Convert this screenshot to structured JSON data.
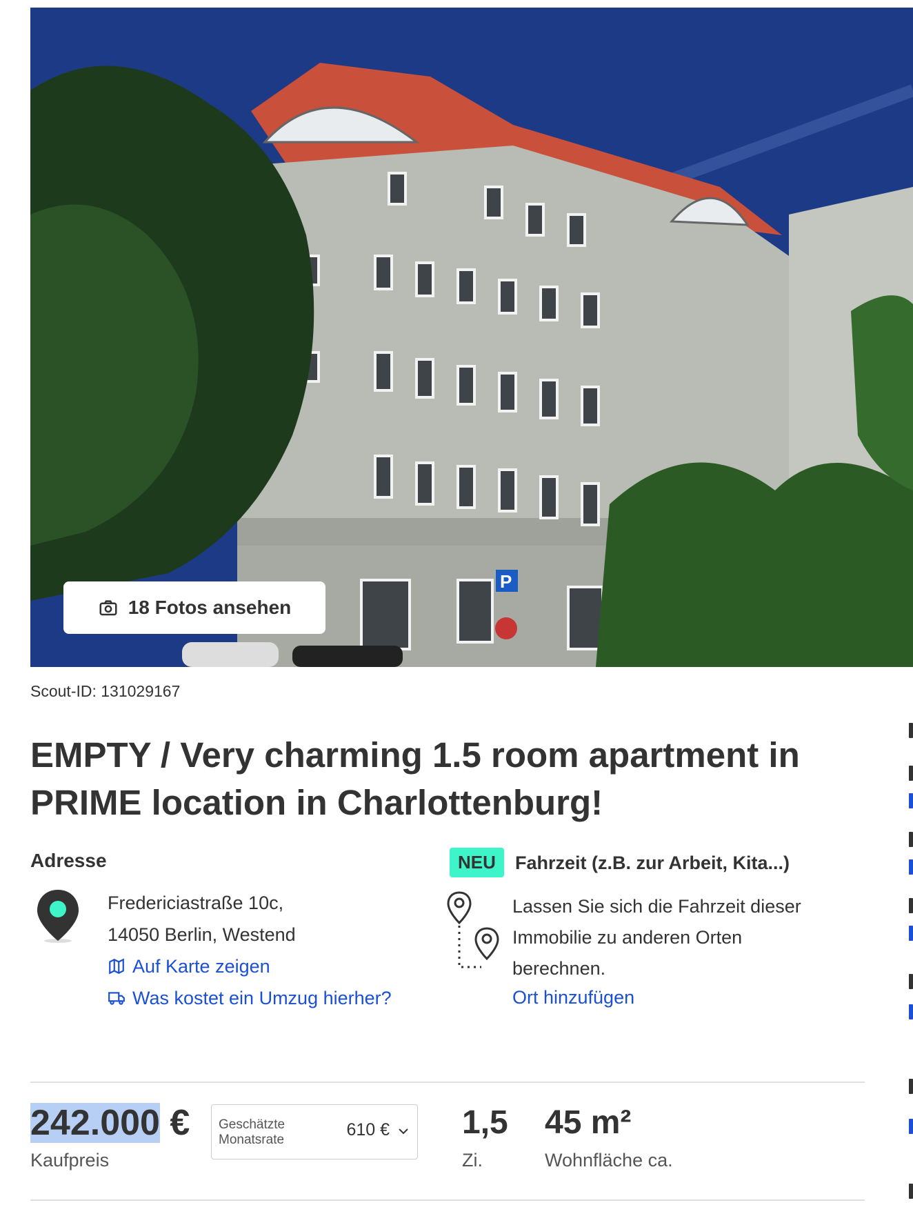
{
  "gallery": {
    "photos_button_label": "18 Fotos ansehen",
    "sky_color": "#1d3a86",
    "roof_color": "#c9503a",
    "facade_color": "#b9bcb4"
  },
  "listing": {
    "scout_id": "Scout-ID: 131029167",
    "title": "EMPTY / Very charming 1.5 room apartment in PRIME location in Charlottenburg!"
  },
  "address": {
    "heading": "Adresse",
    "street": "Fredericiastraße 10c,",
    "city": "14050 Berlin, Westend",
    "map_link": "Auf Karte zeigen",
    "moving_link": "Was kostet ein Umzug hierher?",
    "icon": "map-pin-icon"
  },
  "travel_time": {
    "badge": "NEU",
    "heading": "Fahrzeit (z.B. zur Arbeit, Kita...)",
    "description": "Lassen Sie sich die Fahrzeit dieser Immobilie zu anderen Orten berechnen.",
    "add_link": "Ort hinzufügen"
  },
  "key_facts": {
    "price_value": "242.000",
    "price_currency": "€",
    "price_label": "Kaufpreis",
    "rate_label": "Geschätzte Monatsrate",
    "rate_value": "610 €",
    "rooms_value": "1,5",
    "rooms_label": "Zi.",
    "area_value": "45 m²",
    "area_label": "Wohnfläche ca."
  },
  "colors": {
    "link": "#1b50d3",
    "accent": "#3df5c8",
    "text": "#333333",
    "selection": "#b8cff5"
  }
}
